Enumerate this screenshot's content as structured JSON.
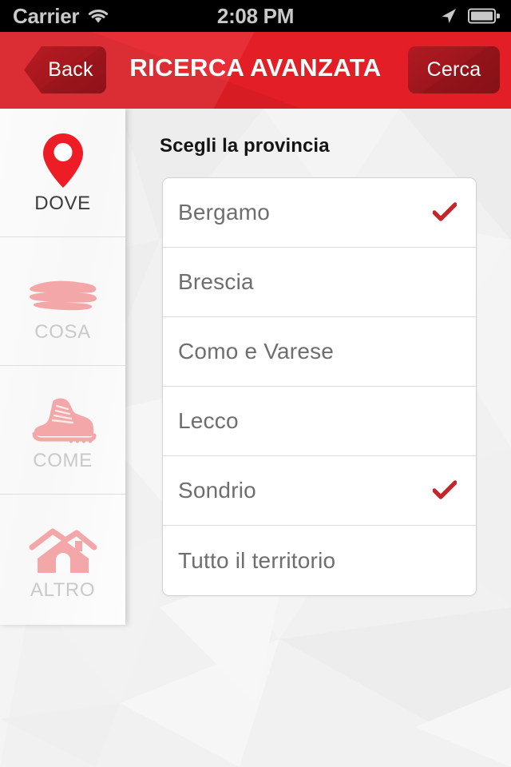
{
  "status_bar": {
    "carrier": "Carrier",
    "time": "2:08 PM",
    "wifi_icon": "wifi-icon",
    "location_icon": "location-arrow-icon",
    "battery_icon": "battery-full-icon"
  },
  "header": {
    "title": "RICERCA AVANZATA",
    "back_label": "Back",
    "search_label": "Cerca",
    "background_color": "#e41e26",
    "button_color": "#9e161d"
  },
  "sidebar": {
    "items": [
      {
        "label": "DOVE",
        "icon": "map-pin-icon",
        "active": true
      },
      {
        "label": "COSA",
        "icon": "paint-stroke-icon",
        "active": false
      },
      {
        "label": "COME",
        "icon": "hiking-boot-icon",
        "active": false
      },
      {
        "label": "ALTRO",
        "icon": "house-icon",
        "active": false
      }
    ]
  },
  "main": {
    "section_title": "Scegli la provincia",
    "accent_color": "#c4262c",
    "options": [
      {
        "label": "Bergamo",
        "selected": true
      },
      {
        "label": "Brescia",
        "selected": false
      },
      {
        "label": "Como e Varese",
        "selected": false
      },
      {
        "label": "Lecco",
        "selected": false
      },
      {
        "label": "Sondrio",
        "selected": true
      },
      {
        "label": "Tutto il territorio",
        "selected": false
      }
    ]
  }
}
